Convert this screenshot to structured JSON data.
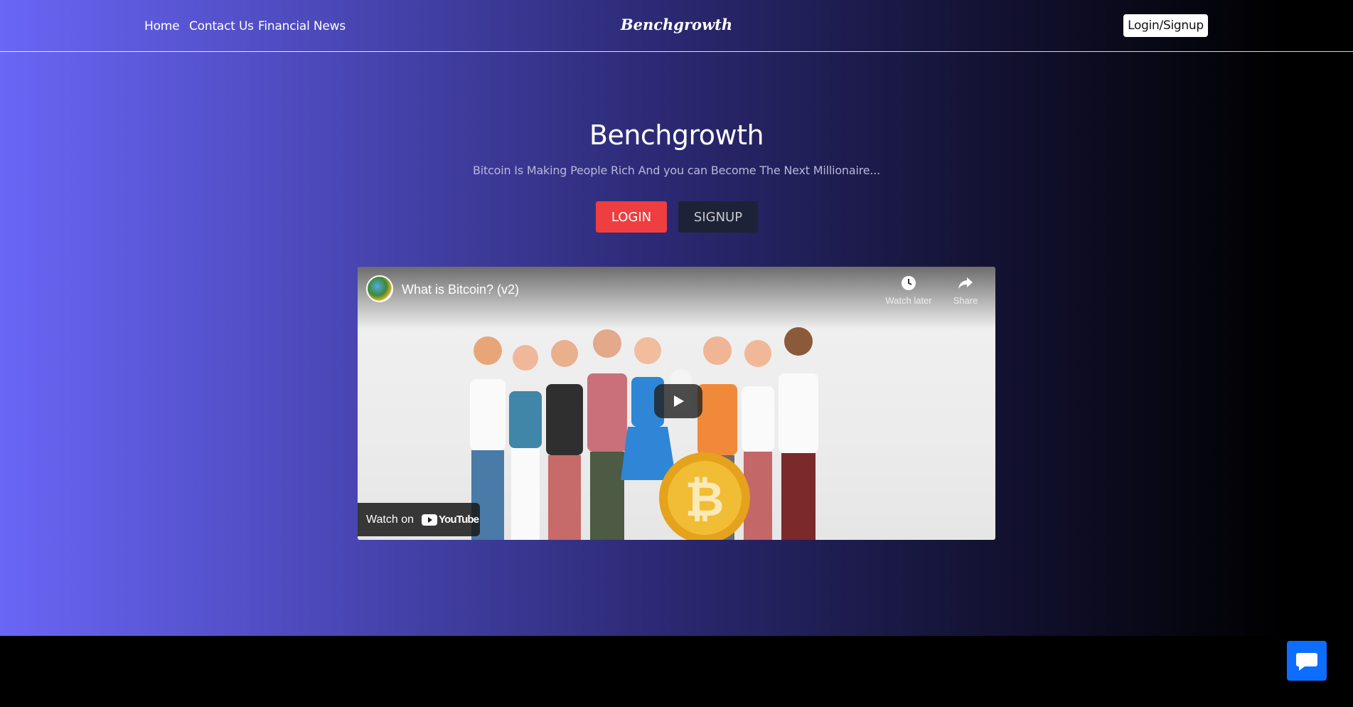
{
  "nav": {
    "links": [
      "Home",
      "Contact Us",
      "Financial News"
    ],
    "brand": "Benchgrowth",
    "auth_button": "Login/Signup"
  },
  "hero": {
    "title": "Benchgrowth",
    "subtitle": "Bitcoin Is Making People Rich And you can Become The Next Millionaire...",
    "login_label": "LOGIN",
    "signup_label": "SIGNUP"
  },
  "video": {
    "title": "What is Bitcoin? (v2)",
    "watch_later": "Watch later",
    "share": "Share",
    "watch_on": "Watch on",
    "youtube": "YouTube"
  },
  "colors": {
    "gradient_start": "#6a66f6",
    "login_button": "#ee3e40",
    "signup_button": "#1d2336",
    "chat_button": "#0d6efd"
  }
}
